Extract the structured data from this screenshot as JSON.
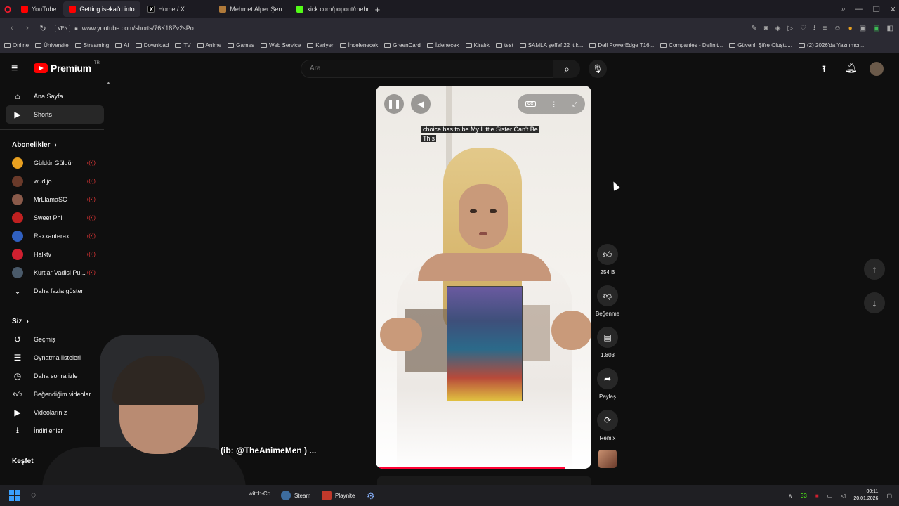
{
  "browser": {
    "tabs": [
      {
        "label": "YouTube",
        "color": "#ff0000",
        "active": false
      },
      {
        "label": "Getting isekai'd into...",
        "color": "#ff0000",
        "active": true
      },
      {
        "label": "Home / X",
        "color": "#000000",
        "active": false
      },
      {
        "label": "Mehmet Alper Şen",
        "color": "#b07a3a",
        "active": false
      },
      {
        "label": "kick.com/popout/mehme",
        "color": "#53fc18",
        "active": false
      }
    ],
    "new_tab": "+",
    "vpn_label": "VPN",
    "url": "www.youtube.com/shorts/76K18Zv2sPo",
    "bookmarks": [
      "Online",
      "Üniversite",
      "Streaming",
      "AI",
      "Download",
      "TV",
      "Anime",
      "Games",
      "Web Service",
      "Kariyer",
      "İncelenecek",
      "GreenCard",
      "İzlenecek",
      "Kiralık",
      "test",
      "SAMLA şeffaf 22 lt k...",
      "Dell PowerEdge T16...",
      "Companies - Definit...",
      "Güvenli Şifre Oluştu...",
      "(2) 2026'da Yazılımcı..."
    ]
  },
  "header": {
    "logo_text": "Premium",
    "logo_region": "TR",
    "search_placeholder": "Ara"
  },
  "sidebar": {
    "main": [
      {
        "label": "Ana Sayfa",
        "icon": "home-icon"
      },
      {
        "label": "Shorts",
        "icon": "shorts-icon",
        "active": true
      }
    ],
    "subs_title": "Abonelikler",
    "subscriptions": [
      {
        "label": "Güldür Güldür",
        "color": "#e8a020"
      },
      {
        "label": "wudijo",
        "color": "#6a3a2a"
      },
      {
        "label": "MrLlamaSC",
        "color": "#8a5a4a"
      },
      {
        "label": "Sweet Phil",
        "color": "#c02020"
      },
      {
        "label": "Raxxanterax",
        "color": "#3060c0"
      },
      {
        "label": "Halktv",
        "color": "#d02030"
      },
      {
        "label": "Kurtlar Vadisi Pu...",
        "color": "#4a5a6a"
      }
    ],
    "show_more": "Daha fazla göster",
    "you_title": "Siz",
    "you_items": [
      {
        "label": "Geçmiş",
        "icon": "history-icon"
      },
      {
        "label": "Oynatma listeleri",
        "icon": "playlist-icon"
      },
      {
        "label": "Daha sonra izle",
        "icon": "watch-later-icon"
      },
      {
        "label": "Beğendiğim videolar",
        "icon": "liked-icon"
      },
      {
        "label": "Videolarınız",
        "icon": "your-videos-icon"
      },
      {
        "label": "İndirilenler",
        "icon": "download-icon"
      }
    ],
    "explore_title": "Keşfet"
  },
  "short": {
    "caption": "choice has to be My Little Sister Can't Be This",
    "progress": 0.88
  },
  "actions": {
    "likes": "254 B",
    "dislike_label": "Beğenme",
    "comments": "1.803",
    "share_label": "Paylaş",
    "remix_label": "Remix"
  },
  "webcam_caption": "(ib: @TheAnimeMen ) ...",
  "taskbar": {
    "apps": [
      {
        "label": "witch-Co",
        "color": "#5a5a5a"
      },
      {
        "label": "Steam",
        "color": "#1b2838"
      },
      {
        "label": "Playnite",
        "color": "#c0392b"
      }
    ],
    "tray_count": "33",
    "time": "00:11",
    "date": "20.01.2026"
  }
}
